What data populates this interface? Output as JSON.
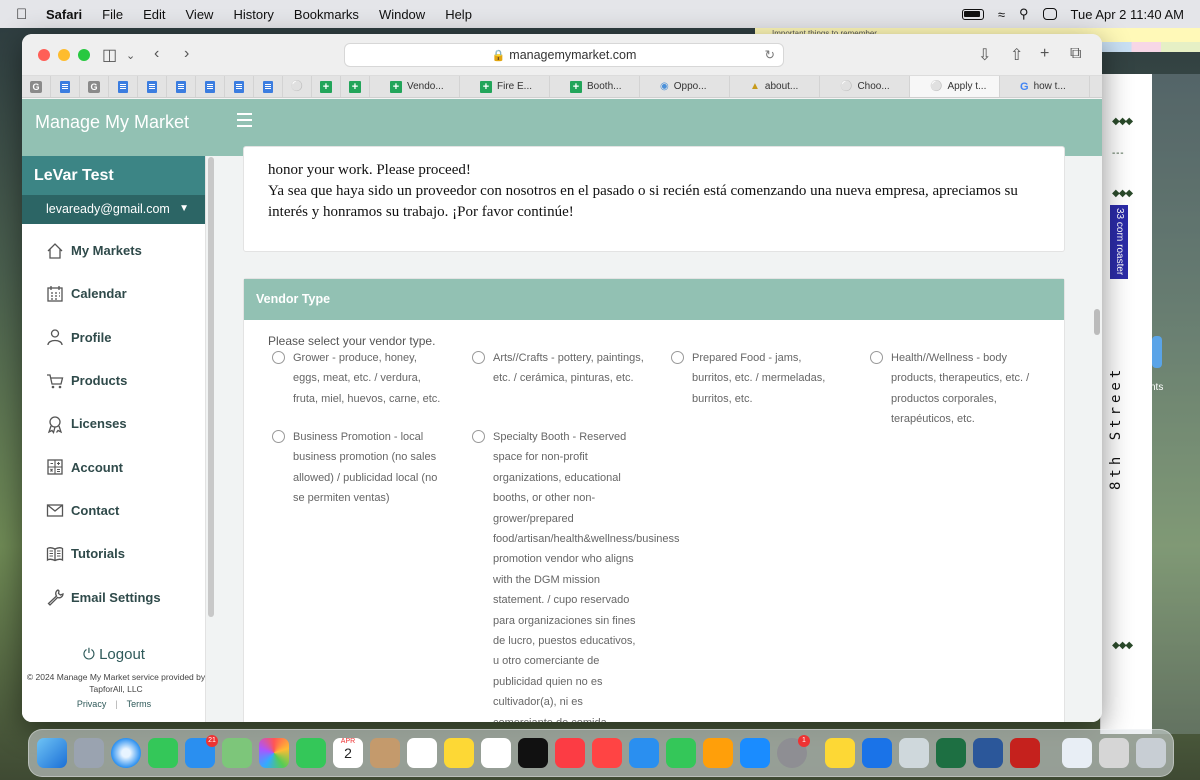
{
  "menubar": {
    "app": "Safari",
    "items": [
      "File",
      "Edit",
      "View",
      "History",
      "Bookmarks",
      "Window",
      "Help"
    ],
    "datetime": "Tue Apr 2  11:40 AM"
  },
  "desktop": {
    "stickies_note": "Important things to remember",
    "street_label": "8th Street",
    "corn_label": "33 corn roaster",
    "side_text": "nts"
  },
  "browser": {
    "url": "managemymarket.com",
    "tabs": [
      {
        "label": "Vendo...",
        "icon": "sheet"
      },
      {
        "label": "Fire E...",
        "icon": "sheet"
      },
      {
        "label": "Booth...",
        "icon": "sheet"
      },
      {
        "label": "Oppo...",
        "icon": "binoculars"
      },
      {
        "label": "about...",
        "icon": "boat"
      },
      {
        "label": "Choo...",
        "icon": "bike"
      },
      {
        "label": "Apply t...",
        "icon": "bike",
        "active": true
      },
      {
        "label": "how t...",
        "icon": "google"
      }
    ]
  },
  "site": {
    "title": "Manage My Market"
  },
  "sidebar": {
    "user_name": "LeVar Test",
    "email": "levaready@gmail.com",
    "items": [
      {
        "label": "My Markets",
        "icon": "home-icon"
      },
      {
        "label": "Calendar",
        "icon": "calendar-icon"
      },
      {
        "label": "Profile",
        "icon": "person-icon"
      },
      {
        "label": "Products",
        "icon": "cart-icon"
      },
      {
        "label": "Licenses",
        "icon": "award-icon"
      },
      {
        "label": "Account",
        "icon": "calculator-icon"
      },
      {
        "label": "Contact",
        "icon": "envelope-icon"
      },
      {
        "label": "Tutorials",
        "icon": "book-icon"
      },
      {
        "label": "Email Settings",
        "icon": "wrench-icon"
      }
    ],
    "logout": "Logout",
    "copyright": "© 2024 Manage My Market service provided by TapforAll, LLC",
    "privacy": "Privacy",
    "terms": "Terms"
  },
  "intro": {
    "line_en": "honor your work. Please proceed!",
    "line_es": "Ya sea que haya sido un proveedor con nosotros en el pasado o si recién está comenzando una nueva empresa, apreciamos su interés y honramos su trabajo. ¡Por favor continúe!"
  },
  "vendor_type": {
    "heading": "Vendor Type",
    "prompt": "Please select your vendor type.",
    "options": [
      "Grower - produce, honey, eggs, meat, etc. / verdura, fruta, miel, huevos, carne, etc.",
      "Arts//Crafts - pottery, paintings, etc. / cerámica, pinturas, etc.",
      "Prepared Food - jams, burritos, etc. / mermeladas, burritos, etc.",
      "Health//Wellness - body products, therapeutics, etc. / productos corporales, terapéuticos, etc.",
      "Business Promotion - local business promotion (no sales allowed) / publicidad local (no se permiten ventas)",
      "Specialty Booth - Reserved space for non-profit organizations, educational booths, or other non-grower/prepared food/artisan/health&wellness/business promotion vendor who aligns with the DGM mission statement. / cupo reservado para organizaciones sin fines de lucro, puestos educativos, u otro comerciante de publicidad quien no es cultivador(a), ni es comerciante de comida preparada/artesanx/salud y"
    ]
  },
  "dock": {
    "mail_badge": "21",
    "calendar_month": "APR",
    "calendar_day": "2",
    "settings_badge": "1"
  }
}
